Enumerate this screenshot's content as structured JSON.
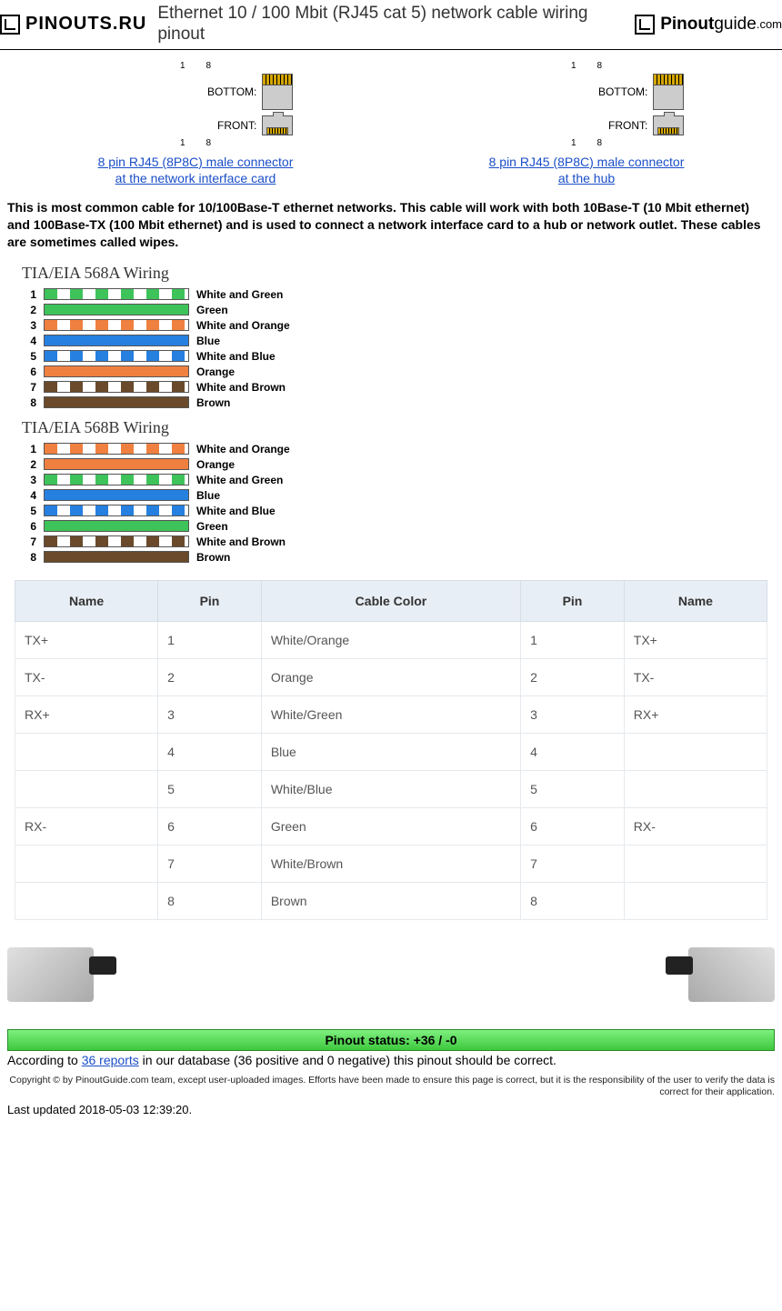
{
  "header": {
    "logo_left": "PINOUTS.RU",
    "title": "Ethernet 10 / 100 Mbit (RJ45 cat 5) network cable wiring pinout",
    "logo_right_bold": "Pinout",
    "logo_right_light": "guide",
    "logo_right_sub": ".com"
  },
  "connectors": {
    "pin_lo": "1",
    "pin_hi": "8",
    "bottom_label": "BOTTOM:",
    "front_label": "FRONT:",
    "left_link_l1": "8 pin RJ45 (8P8C) male connector",
    "left_link_l2": "at the network interface card",
    "right_link_l1": "8 pin RJ45 (8P8C) male connector",
    "right_link_l2": "at the hub"
  },
  "intro": "This is most common cable for 10/100Base-T ethernet networks. This cable will work with both 10Base-T (10 Mbit ethernet) and 100Base-TX (100 Mbit ethernet) and is used to connect a network interface card to a hub or network outlet. These cables are sometimes called wipes.",
  "wiring_a": {
    "title": "TIA/EIA 568A Wiring",
    "rows": [
      {
        "n": "1",
        "label": "White and Green",
        "striped": true,
        "color": "#3ec35a"
      },
      {
        "n": "2",
        "label": "Green",
        "striped": false,
        "color": "#3ec35a"
      },
      {
        "n": "3",
        "label": "White and Orange",
        "striped": true,
        "color": "#f08040"
      },
      {
        "n": "4",
        "label": "Blue",
        "striped": false,
        "color": "#2680e0"
      },
      {
        "n": "5",
        "label": "White and Blue",
        "striped": true,
        "color": "#2680e0"
      },
      {
        "n": "6",
        "label": "Orange",
        "striped": false,
        "color": "#f08040"
      },
      {
        "n": "7",
        "label": "White and Brown",
        "striped": true,
        "color": "#6a4a2a"
      },
      {
        "n": "8",
        "label": "Brown",
        "striped": false,
        "color": "#6a4a2a"
      }
    ]
  },
  "wiring_b": {
    "title": "TIA/EIA 568B Wiring",
    "rows": [
      {
        "n": "1",
        "label": "White and Orange",
        "striped": true,
        "color": "#f08040"
      },
      {
        "n": "2",
        "label": "Orange",
        "striped": false,
        "color": "#f08040"
      },
      {
        "n": "3",
        "label": "White and Green",
        "striped": true,
        "color": "#3ec35a"
      },
      {
        "n": "4",
        "label": "Blue",
        "striped": false,
        "color": "#2680e0"
      },
      {
        "n": "5",
        "label": "White and Blue",
        "striped": true,
        "color": "#2680e0"
      },
      {
        "n": "6",
        "label": "Green",
        "striped": false,
        "color": "#3ec35a"
      },
      {
        "n": "7",
        "label": "White and Brown",
        "striped": true,
        "color": "#6a4a2a"
      },
      {
        "n": "8",
        "label": "Brown",
        "striped": false,
        "color": "#6a4a2a"
      }
    ]
  },
  "table": {
    "headers": [
      "Name",
      "Pin",
      "Cable Color",
      "Pin",
      "Name"
    ],
    "rows": [
      [
        "TX+",
        "1",
        "White/Orange",
        "1",
        "TX+"
      ],
      [
        "TX-",
        "2",
        "Orange",
        "2",
        "TX-"
      ],
      [
        "RX+",
        "3",
        "White/Green",
        "3",
        "RX+"
      ],
      [
        "",
        "4",
        "Blue",
        "4",
        ""
      ],
      [
        "",
        "5",
        "White/Blue",
        "5",
        ""
      ],
      [
        "RX-",
        "6",
        "Green",
        "6",
        "RX-"
      ],
      [
        "",
        "7",
        "White/Brown",
        "7",
        ""
      ],
      [
        "",
        "8",
        "Brown",
        "8",
        ""
      ]
    ]
  },
  "status": {
    "bar": "Pinout status: +36 / -0",
    "prefix": "According to ",
    "link": "36 reports",
    "suffix": " in our database (36 positive and 0 negative) this pinout should be correct."
  },
  "copyright": "Copyright © by PinoutGuide.com team, except user-uploaded images. Efforts have been made to ensure this page is correct, but it is the responsibility of the user to verify the data is correct for their application.",
  "updated": "Last updated 2018-05-03 12:39:20."
}
